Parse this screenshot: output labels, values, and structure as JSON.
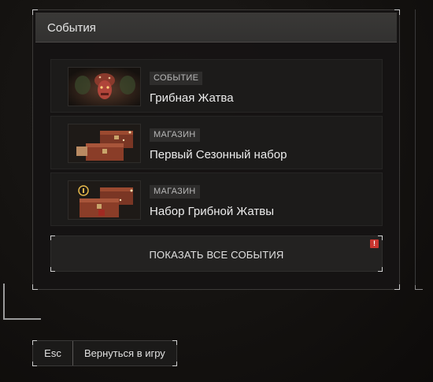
{
  "panel": {
    "title": "События"
  },
  "events": [
    {
      "tag": "СОБЫТИЕ",
      "name": "Грибная Жатва",
      "thumb": "mushroom-harvest-artwork"
    },
    {
      "tag": "МАГАЗИН",
      "name": "Первый Сезонный набор",
      "thumb": "supply-crates-artwork"
    },
    {
      "tag": "МАГАЗИН",
      "name": "Набор Грибной Жатвы",
      "thumb": "harvest-crates-artwork"
    }
  ],
  "show_all": {
    "label": "ПОКАЗАТЬ ВСЕ СОБЫТИЯ",
    "badge": "!"
  },
  "footer": {
    "key": "Esc",
    "label": "Вернуться в игру"
  },
  "colors": {
    "accent_alert": "#c8352f",
    "panel_bg": "#161413",
    "header_bg": "#363533"
  }
}
